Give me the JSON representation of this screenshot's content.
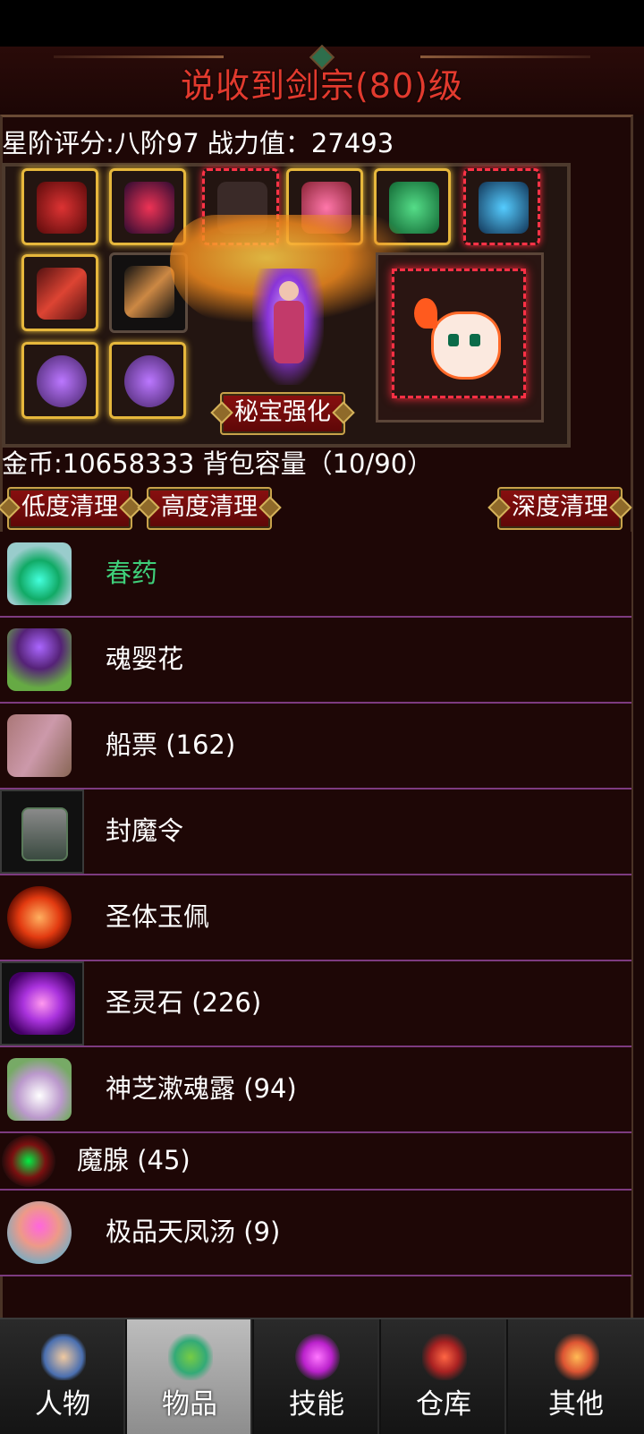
{
  "header": {
    "title": "说收到剑宗(80)级"
  },
  "stats": {
    "line": "星阶评分:八阶97 战力值：27493"
  },
  "equipment": {
    "slots": [
      {
        "icon": "helmet-icon"
      },
      {
        "icon": "armor-icon"
      },
      {
        "icon": "empty-slot"
      },
      {
        "icon": "bracer-icon"
      },
      {
        "icon": "green-armor-icon"
      },
      {
        "icon": "beast-mask-icon"
      },
      {
        "icon": "sword-icon"
      },
      {
        "icon": "dagger-icon"
      },
      {
        "icon": "ring-icon"
      },
      {
        "icon": "ring-icon"
      }
    ],
    "treasure_button": "秘宝强化",
    "pet_icon": "fire-pet-icon"
  },
  "inventory_info": "金币:10658333 背包容量（10/90）",
  "buttons": {
    "low_clean": "低度清理",
    "high_clean": "高度清理",
    "deep_clean": "深度清理"
  },
  "items": [
    {
      "name": "春药",
      "icon": "potion-bottle-icon",
      "color": "#3fcf7a"
    },
    {
      "name": "魂婴花",
      "icon": "purple-flower-icon"
    },
    {
      "name": "船票 (162)",
      "icon": "scroll-icon"
    },
    {
      "name": "封魔令",
      "icon": "seal-token-icon"
    },
    {
      "name": "圣体玉佩",
      "icon": "fire-orb-icon"
    },
    {
      "name": "圣灵石 (226)",
      "icon": "purple-crystal-icon"
    },
    {
      "name": "神芝漱魂露 (94)",
      "icon": "diamond-flask-icon"
    },
    {
      "name": "魔腺 (45)",
      "icon": "dark-orb-icon"
    },
    {
      "name": "极品天凤汤 (9)",
      "icon": "soup-bowl-icon"
    }
  ],
  "tabs": [
    {
      "label": "人物",
      "icon": "character-icon",
      "active": false
    },
    {
      "label": "物品",
      "icon": "items-bag-icon",
      "active": true
    },
    {
      "label": "技能",
      "icon": "skill-swirl-icon",
      "active": false
    },
    {
      "label": "仓库",
      "icon": "warehouse-icon",
      "active": false
    },
    {
      "label": "其他",
      "icon": "other-icon",
      "active": false
    }
  ],
  "colors": {
    "title_red": "#e23a2e",
    "divider_purple": "#7d3b80",
    "highlight_green": "#3fcf7a"
  }
}
